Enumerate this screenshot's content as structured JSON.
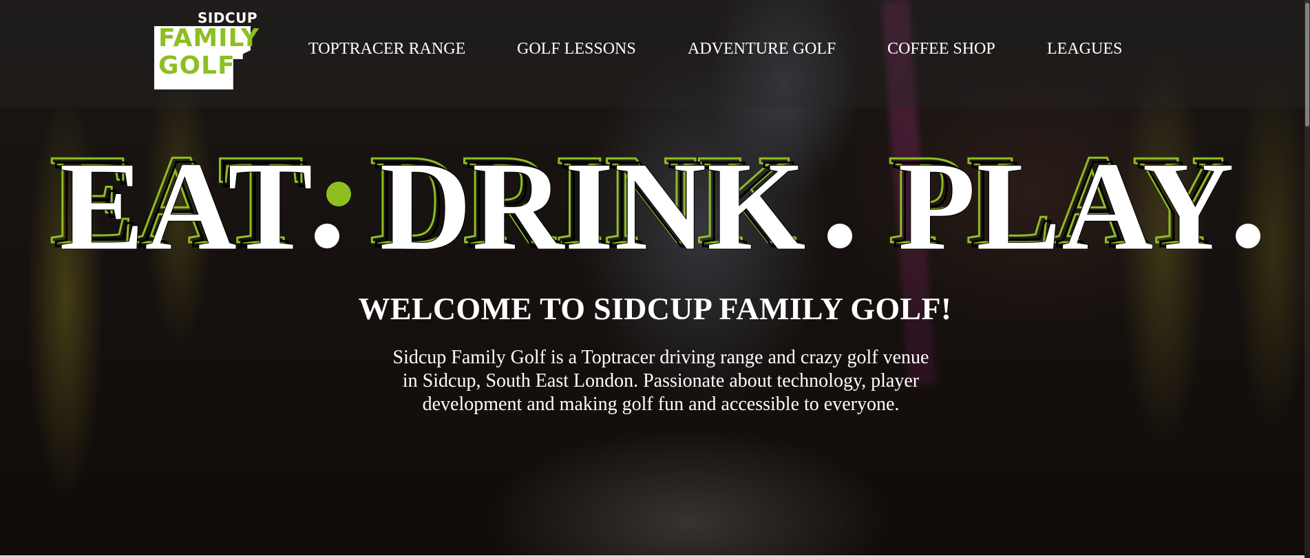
{
  "brand": {
    "logo_top": "SIDCUP",
    "logo_line1": "FAMILY",
    "logo_line2": "GOLF",
    "accent_color": "#8dbf21"
  },
  "nav": {
    "items": [
      {
        "label": "TOPTRACER RANGE"
      },
      {
        "label": "GOLF LESSONS"
      },
      {
        "label": "ADVENTURE GOLF"
      },
      {
        "label": "COFFEE SHOP"
      },
      {
        "label": "LEAGUES"
      }
    ]
  },
  "hero": {
    "words": [
      "EAT",
      "DRINK",
      "PLAY"
    ],
    "separator": ".",
    "welcome": "WELCOME TO SIDCUP FAMILY GOLF!",
    "intro": "Sidcup Family Golf is a Toptracer driving range and crazy golf venue in Sidcup, South East London. Passionate about technology, player development and making golf fun and accessible to everyone."
  }
}
